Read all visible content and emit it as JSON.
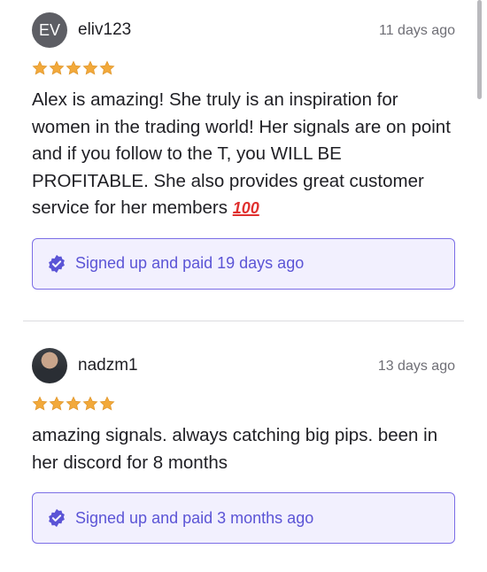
{
  "reviews": [
    {
      "avatar_initials": "EV",
      "username": "eliv123",
      "time": "11 days ago",
      "rating": 5,
      "text_main": "Alex is amazing! She truly is an inspiration for women in the trading world! Her signals are on point and if you follow to the T, you WILL BE PROFITABLE. She also provides great customer service for her members ",
      "emoji": "100",
      "verified": "Signed up and paid 19 days ago"
    },
    {
      "avatar_initials": "",
      "username": "nadzm1",
      "time": "13 days ago",
      "rating": 5,
      "text_main": "amazing signals. always catching big pips. been in her discord for 8 months",
      "verified": "Signed up and paid 3 months ago"
    }
  ],
  "colors": {
    "star": "#f2a93b",
    "accent": "#5b54d6",
    "verified_bg": "#f2f0fe",
    "verified_border": "#7b6ee6"
  },
  "icons": [
    "star-icon",
    "verified-badge-icon",
    "hundred-points-emoji"
  ]
}
